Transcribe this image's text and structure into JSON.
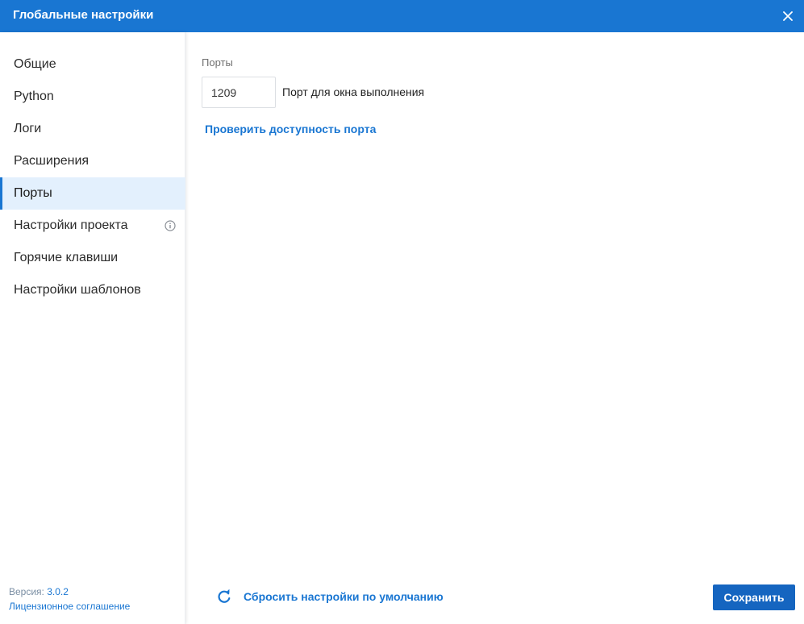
{
  "window": {
    "title": "Глобальные настройки",
    "close_icon": "close-icon"
  },
  "sidebar": {
    "items": [
      {
        "label": "Общие",
        "active": false
      },
      {
        "label": "Python",
        "active": false
      },
      {
        "label": "Логи",
        "active": false
      },
      {
        "label": "Расширения",
        "active": false
      },
      {
        "label": "Порты",
        "active": true
      },
      {
        "label": "Настройки проекта",
        "active": false,
        "icon": "info-icon"
      },
      {
        "label": "Горячие клавиши",
        "active": false
      },
      {
        "label": "Настройки шаблонов",
        "active": false
      }
    ],
    "footer": {
      "version_label": "Версия: ",
      "version_value": "3.0.2",
      "license_link": "Лицензионное соглашение"
    }
  },
  "ports": {
    "section_label": "Порты",
    "port_value": "1209",
    "port_caption": "Порт для окна выполнения",
    "check_link": "Проверить доступность порта"
  },
  "footer": {
    "reset_label": "Сбросить настройки по умолчанию",
    "reset_icon": "refresh-icon",
    "save_label": "Сохранить"
  },
  "colors": {
    "accent": "#1976d2",
    "titlebar": "#1976d2",
    "active_item_bg": "#e3f0fd",
    "save_button": "#1565c0"
  }
}
